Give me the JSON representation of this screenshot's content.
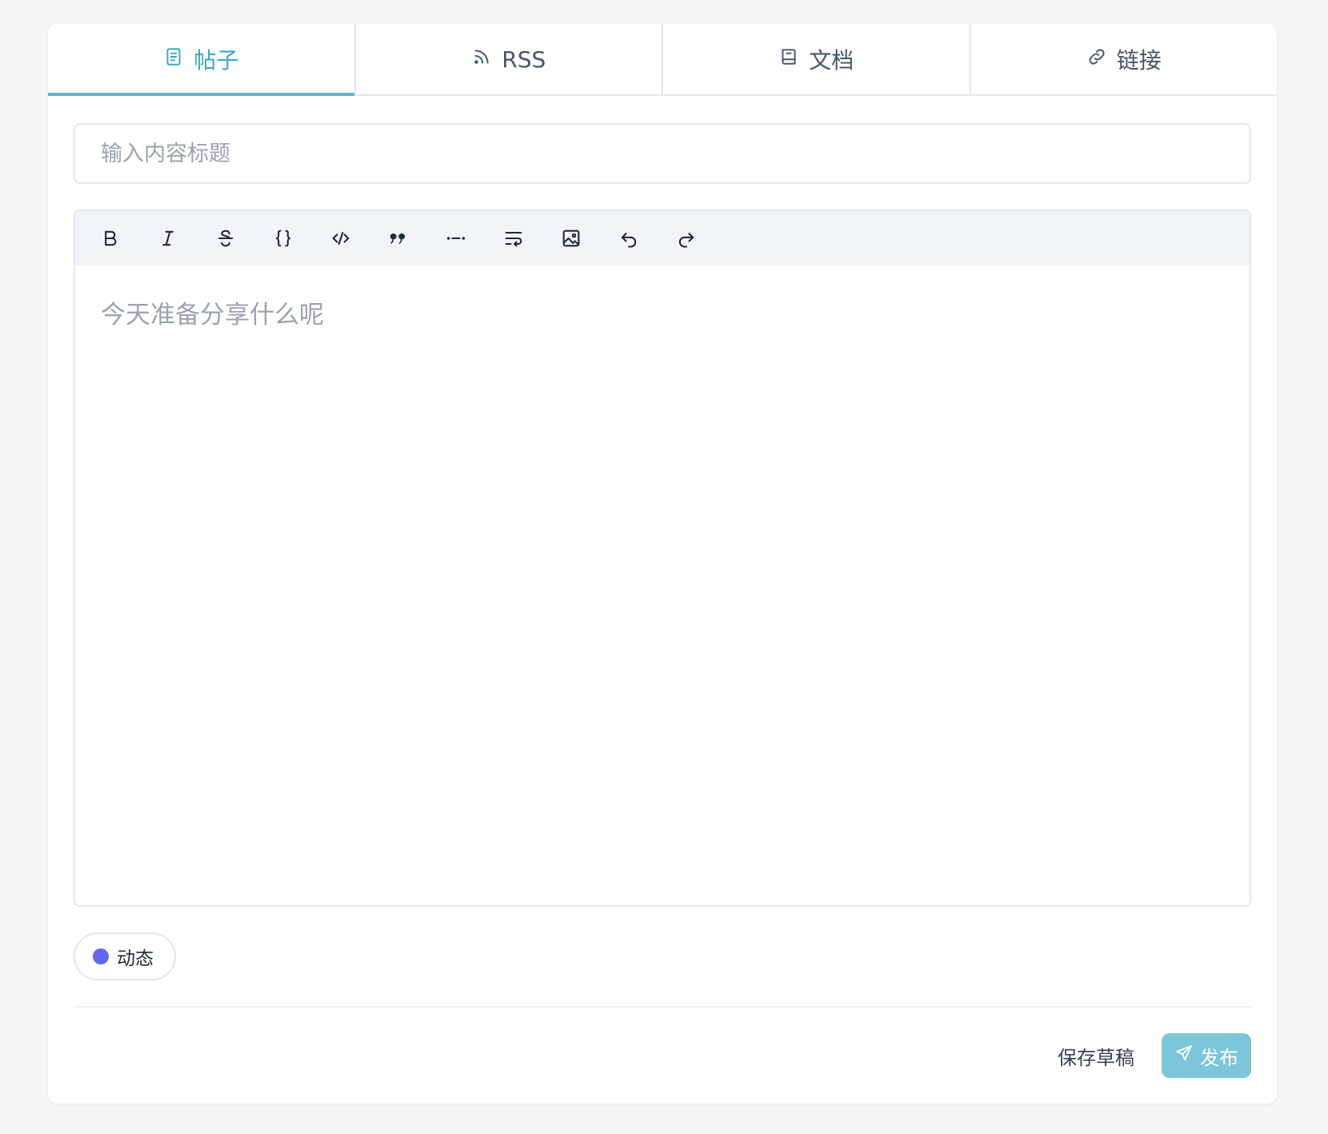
{
  "colors": {
    "accent": "#3aa8c6",
    "publish_bg": "#7cc6da",
    "tag_dot": "#6366f1"
  },
  "tabs": [
    {
      "label": "帖子",
      "icon": "document-icon",
      "active": true
    },
    {
      "label": "RSS",
      "icon": "rss-icon",
      "active": false
    },
    {
      "label": "文档",
      "icon": "book-icon",
      "active": false
    },
    {
      "label": "链接",
      "icon": "link-icon",
      "active": false
    }
  ],
  "title_input": {
    "value": "",
    "placeholder": "输入内容标题"
  },
  "toolbar": {
    "tools": [
      "bold",
      "italic",
      "strikethrough",
      "code-block",
      "code",
      "quote",
      "horizontal-rule",
      "wrap",
      "image",
      "undo",
      "redo"
    ]
  },
  "editor": {
    "value": "",
    "placeholder": "今天准备分享什么呢"
  },
  "tag": {
    "label": "动态"
  },
  "actions": {
    "save_draft": "保存草稿",
    "publish": "发布"
  }
}
